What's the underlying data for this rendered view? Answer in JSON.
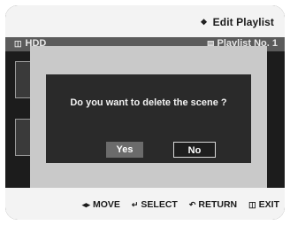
{
  "header": {
    "title": "Edit Playlist",
    "title_icon": "diamond-icon"
  },
  "infobar": {
    "left_label": "HDD",
    "right_label": "Playlist No. 1"
  },
  "dialog": {
    "message": "Do you want to delete the scene ?",
    "yes_label": "Yes",
    "no_label": "No",
    "selected": "No"
  },
  "footer": {
    "move_label": "MOVE",
    "select_label": "SELECT",
    "return_label": "RETURN",
    "exit_label": "EXIT"
  },
  "colors": {
    "background": "#1c1c1c",
    "bars": "#f3f3f3",
    "dialog_frame": "#c9c9c9",
    "dialog": "#2a2a2a",
    "yes_button": "#6b6b6b"
  }
}
